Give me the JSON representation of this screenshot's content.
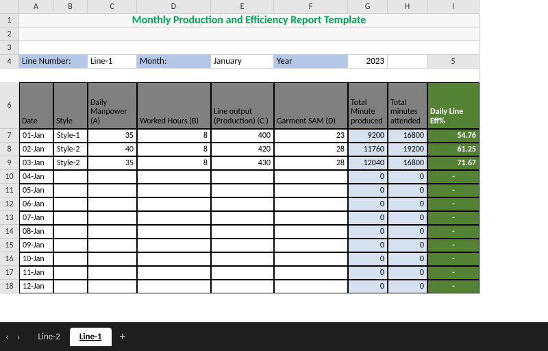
{
  "cols": [
    "A",
    "B",
    "C",
    "D",
    "E",
    "F",
    "G",
    "H",
    "I"
  ],
  "title": "Monthly Production and Efficiency Report Template",
  "meta": {
    "lineNumberLabel": "Line Number:",
    "lineNumber": "Line-1",
    "monthLabel": "Month:",
    "month": "January",
    "yearLabel": "Year",
    "year": "2023"
  },
  "headers": {
    "date": "Date",
    "style": "Style",
    "manpower": "Daily Manpower (A)",
    "worked": "Worked Hours (B)",
    "output": "Line output (Production) (C )",
    "sam": "Garment SAM (D)",
    "produced": "Total Minute produced",
    "attended": "Total minutes attended",
    "eff": "Daily Line Eff%"
  },
  "rows": [
    {
      "n": "7",
      "date": "01-Jan",
      "style": "Style-1",
      "manpower": "35",
      "worked": "8",
      "output": "400",
      "sam": "23",
      "produced": "9200",
      "attended": "16800",
      "eff": "54.76"
    },
    {
      "n": "8",
      "date": "02-Jan",
      "style": "Style-2",
      "manpower": "40",
      "worked": "8",
      "output": "420",
      "sam": "28",
      "produced": "11760",
      "attended": "19200",
      "eff": "61.25"
    },
    {
      "n": "9",
      "date": "03-Jan",
      "style": "Style-2",
      "manpower": "35",
      "worked": "8",
      "output": "430",
      "sam": "28",
      "produced": "12040",
      "attended": "16800",
      "eff": "71.67"
    },
    {
      "n": "10",
      "date": "04-Jan",
      "style": "",
      "manpower": "",
      "worked": "",
      "output": "",
      "sam": "",
      "produced": "0",
      "attended": "0",
      "eff": "-"
    },
    {
      "n": "11",
      "date": "05-Jan",
      "style": "",
      "manpower": "",
      "worked": "",
      "output": "",
      "sam": "",
      "produced": "0",
      "attended": "0",
      "eff": "-"
    },
    {
      "n": "12",
      "date": "06-Jan",
      "style": "",
      "manpower": "",
      "worked": "",
      "output": "",
      "sam": "",
      "produced": "0",
      "attended": "0",
      "eff": "-"
    },
    {
      "n": "13",
      "date": "07-Jan",
      "style": "",
      "manpower": "",
      "worked": "",
      "output": "",
      "sam": "",
      "produced": "0",
      "attended": "0",
      "eff": "-"
    },
    {
      "n": "14",
      "date": "08-Jan",
      "style": "",
      "manpower": "",
      "worked": "",
      "output": "",
      "sam": "",
      "produced": "0",
      "attended": "0",
      "eff": "-"
    },
    {
      "n": "15",
      "date": "09-Jan",
      "style": "",
      "manpower": "",
      "worked": "",
      "output": "",
      "sam": "",
      "produced": "0",
      "attended": "0",
      "eff": "-"
    },
    {
      "n": "16",
      "date": "10-Jan",
      "style": "",
      "manpower": "",
      "worked": "",
      "output": "",
      "sam": "",
      "produced": "0",
      "attended": "0",
      "eff": "-"
    },
    {
      "n": "17",
      "date": "11-Jan",
      "style": "",
      "manpower": "",
      "worked": "",
      "output": "",
      "sam": "",
      "produced": "0",
      "attended": "0",
      "eff": "-"
    },
    {
      "n": "18",
      "date": "12-Jan",
      "style": "",
      "manpower": "",
      "worked": "",
      "output": "",
      "sam": "",
      "produced": "0",
      "attended": "0",
      "eff": "-"
    }
  ],
  "sheets": {
    "inactive": "Line-2",
    "active": "Line-1"
  },
  "nav": {
    "prev": "‹",
    "next": "›",
    "plus": "+"
  }
}
